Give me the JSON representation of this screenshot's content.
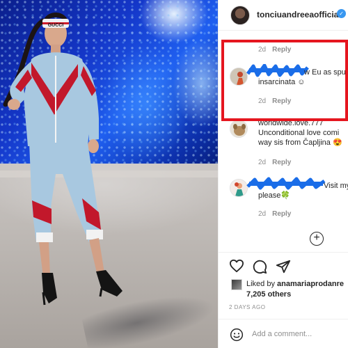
{
  "post": {
    "username": "tonciuandreeaofficial",
    "verified_glyph": "✓",
    "photo": {
      "headband_text": "GUCCI"
    }
  },
  "comments": [
    {
      "lines": [],
      "time": "2d",
      "reply_label": "Reply",
      "avatar_icon": "avatar-dark-icon"
    },
    {
      "lines": [
        "w Eu as spur",
        "insarcinata ☺"
      ],
      "time": "2d",
      "reply_label": "Reply",
      "avatar_icon": "avatar-person-icon",
      "highlighted": true,
      "name_redacted": true
    },
    {
      "lines": [
        "worldwide.love.777",
        "Unconditional love comi",
        "way sis from Čapljina 😍"
      ],
      "time": "2d",
      "reply_label": "Reply",
      "avatar_icon": "avatar-dog-icon"
    },
    {
      "lines": [
        "Visit my",
        "please🍀"
      ],
      "time": "2d",
      "reply_label": "Reply",
      "avatar_icon": "avatar-cartoon-icon",
      "name_redacted": true
    }
  ],
  "load_more_icon": "plus-circle-icon",
  "actions": {
    "icons": [
      "heart-icon",
      "comment-icon",
      "share-icon"
    ]
  },
  "likes": {
    "liked_by_prefix": "Liked by ",
    "liked_by_user": "anamariaprodanre",
    "count_prefix": "7,205",
    "count_suffix": " others"
  },
  "post_age": "2 DAYS AGO",
  "add_comment": {
    "placeholder": "Add a comment...",
    "icon": "smile-icon"
  },
  "colors": {
    "highlight": "#e5161f",
    "scribble": "#1a6de8",
    "verified": "#3897f0"
  }
}
